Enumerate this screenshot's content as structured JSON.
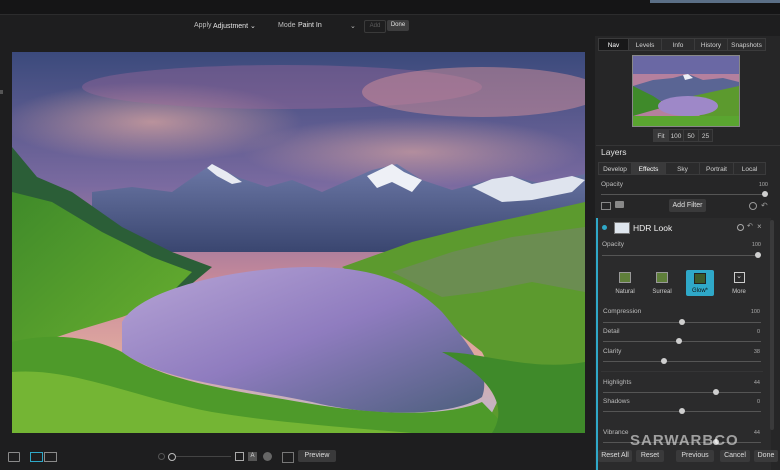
{
  "toolbar": {
    "apply_label": "Apply",
    "apply_value": "Adjustment",
    "mode_label": "Mode",
    "mode_value": "Paint In",
    "add_label": "Add",
    "done_label": "Done"
  },
  "right_tabs": [
    "Nav",
    "Levels",
    "Info",
    "History",
    "Snapshots"
  ],
  "zoom_buttons": [
    "Fit",
    "100",
    "50",
    "25"
  ],
  "layers": {
    "title": "Layers",
    "tabs": [
      "Develop",
      "Effects",
      "Sky",
      "Portrait",
      "Local"
    ],
    "opacity_label": "Opacity",
    "opacity_value": "100",
    "add_filter_label": "Add Filter"
  },
  "filter": {
    "name": "HDR Look",
    "opacity_label": "Opacity",
    "opacity_value": "100",
    "presets": [
      "Natural",
      "Surreal",
      "Glow*",
      "More"
    ],
    "sliders": [
      {
        "label": "Compression",
        "value": "100"
      },
      {
        "label": "Detail",
        "value": "0"
      },
      {
        "label": "Clarity",
        "value": "38"
      },
      {
        "label": "Highlights",
        "value": "44"
      },
      {
        "label": "Shadows",
        "value": "0"
      },
      {
        "label": "Vibrance",
        "value": "44"
      }
    ]
  },
  "footer": {
    "preview_label": "Preview",
    "reset_all_label": "Reset All",
    "reset_label": "Reset",
    "previous_label": "Previous",
    "cancel_label": "Cancel",
    "done_label": "Done",
    "watermark": "SARWARBCO"
  },
  "colors": {
    "accent": "#2fa8c8",
    "panel_bg": "#262627",
    "app_bg": "#1e1e1f"
  }
}
